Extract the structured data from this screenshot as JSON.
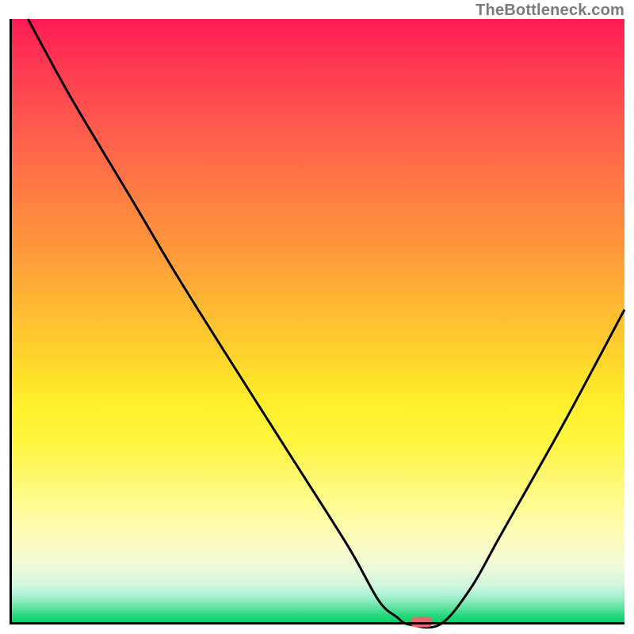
{
  "attribution": "TheBottleneck.com",
  "chart_data": {
    "type": "line",
    "title": "",
    "xlabel": "",
    "ylabel": "",
    "xlim": [
      0,
      100
    ],
    "ylim": [
      0,
      100
    ],
    "series": [
      {
        "name": "bottleneck-curve",
        "x": [
          3,
          10,
          20,
          27,
          35,
          45,
          55,
          60,
          63,
          65,
          70,
          75,
          80,
          90,
          100
        ],
        "y": [
          100,
          87,
          70,
          58,
          45,
          29,
          13,
          4,
          1.2,
          0,
          0,
          6,
          15,
          33,
          52
        ]
      }
    ],
    "optimum": {
      "x": 67,
      "y": 0
    },
    "marker_color": "#e16a6a",
    "gradient_stops": [
      {
        "pos": 0,
        "color": "#ff1a55"
      },
      {
        "pos": 0.5,
        "color": "#ffd22c"
      },
      {
        "pos": 0.82,
        "color": "#fdfcb0"
      },
      {
        "pos": 1.0,
        "color": "#00cf62"
      }
    ]
  }
}
